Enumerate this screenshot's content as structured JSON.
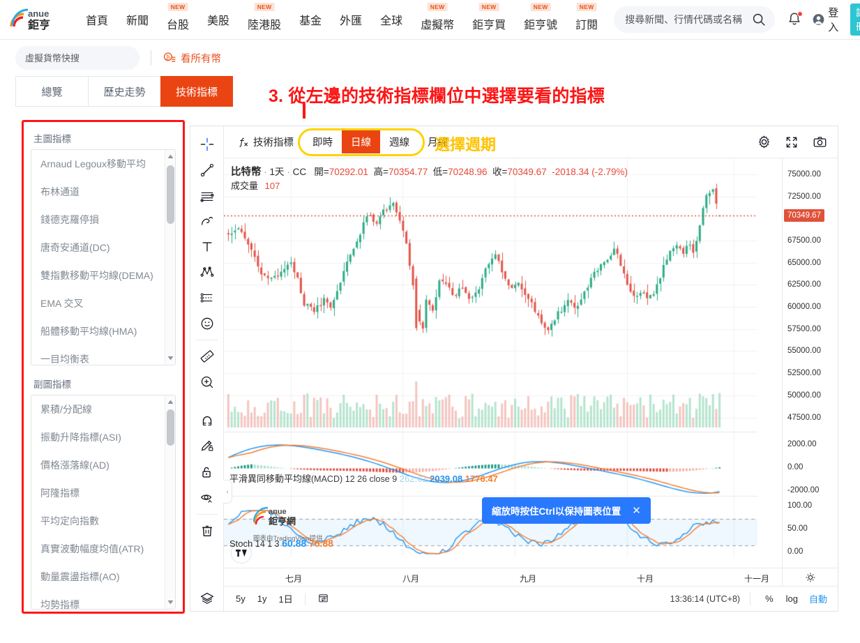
{
  "header": {
    "logo_text_top": "anue",
    "logo_text_bottom": "鉅亨",
    "nav": [
      {
        "label": "首頁",
        "badge": ""
      },
      {
        "label": "新聞",
        "badge": ""
      },
      {
        "label": "台股",
        "badge": "NEW"
      },
      {
        "label": "美股",
        "badge": ""
      },
      {
        "label": "陸港股",
        "badge": "NEW"
      },
      {
        "label": "基金",
        "badge": ""
      },
      {
        "label": "外匯",
        "badge": ""
      },
      {
        "label": "全球",
        "badge": ""
      },
      {
        "label": "虛擬幣",
        "badge": "NEW"
      },
      {
        "label": "鉅亨買",
        "badge": "NEW"
      },
      {
        "label": "鉅亨號",
        "badge": "NEW"
      },
      {
        "label": "訂閱",
        "badge": "NEW"
      }
    ],
    "search_placeholder": "搜尋新聞、行情代碼或名稱",
    "search_value": "",
    "login_label": "登入",
    "register_label": "註冊"
  },
  "subbar": {
    "coin_search_placeholder": "虛擬貨幣快搜",
    "coin_search_value": "",
    "all_coins_label": "看所有幣"
  },
  "tabs": [
    {
      "label": "總覽",
      "active": false
    },
    {
      "label": "歷史走勢",
      "active": false
    },
    {
      "label": "技術指標",
      "active": true
    }
  ],
  "annotations": {
    "step3": "3. 從左邊的技術指標欄位中選擇要看的指標",
    "period_hint": "選擇週期"
  },
  "left_panel": {
    "main_title": "主圖指標",
    "main_items": [
      "Arnaud Legoux移動平均",
      "布林通道",
      "錢德克羅停損",
      "唐奇安通道(DC)",
      "雙指數移動平均線(DEMA)",
      "EMA 交叉",
      "船體移動平均線(HMA)",
      "一目均衡表"
    ],
    "sub_title": "副圖指標",
    "sub_items": [
      "累積/分配線",
      "振動升降指標(ASI)",
      "價格漲落線(AD)",
      "阿隆指標",
      "平均定向指數",
      "真實波動幅度均值(ATR)",
      "動量震盪指標(AO)",
      "均勢指標"
    ]
  },
  "chart_toolbar": {
    "indicator_button": "技術指標",
    "periods": [
      {
        "label": "即時",
        "active": false
      },
      {
        "label": "日線",
        "active": true
      },
      {
        "label": "週線",
        "active": false
      },
      {
        "label": "月線",
        "active": false
      }
    ]
  },
  "chart_legend": {
    "symbol": "比特幣",
    "interval": "1天",
    "exchange": "CC",
    "open_label": "開=",
    "open": "70292.01",
    "high_label": "高=",
    "high": "70354.77",
    "low_label": "低=",
    "low": "70248.96",
    "close_label": "收=",
    "close": "70349.67",
    "change": "-2018.34 (-2.79%)",
    "volume_label": "成交量",
    "volume": "107"
  },
  "macd_legend": {
    "name": "平滑異同移動平均線",
    "abbr": "(MACD)",
    "params": "12 26 close 9",
    "hist": "262.61",
    "macd": "2039.08",
    "signal": "1776.47"
  },
  "stoch_legend": {
    "name": "Stoch",
    "params": "14 1 3",
    "k": "60.88",
    "d": "76.88"
  },
  "price_axis": [
    "75000.00",
    "72500.00",
    "67500.00",
    "65000.00",
    "62500.00",
    "60000.00",
    "57500.00",
    "55000.00",
    "52500.00",
    "50000.00",
    "47500.00"
  ],
  "price_axis_current": "70349.67",
  "macd_axis": [
    "2000.00",
    "0.00",
    "-2000.00"
  ],
  "stoch_axis": [
    "100.00",
    "50.00",
    "0.00"
  ],
  "time_axis": [
    "七月",
    "八月",
    "九月",
    "十月",
    "十一月"
  ],
  "bottom_bar": {
    "ranges": [
      "5y",
      "1y",
      "1日"
    ],
    "clock": "13:36:14 (UTC+8)",
    "percent": "%",
    "log": "log",
    "auto": "自動"
  },
  "tooltip": {
    "text": "縮放時按住Ctrl以保持圖表位置",
    "close": "✕"
  },
  "watermark": {
    "top": "anue",
    "bottom": "鉅亨網",
    "credit": "圖表由TradingView提供"
  },
  "colors": {
    "brand_orange": "#ea4412",
    "accent_red": "#fc1616",
    "highlight_yellow": "#ffd200",
    "up_green": "#26a69a",
    "down_red": "#e0513a",
    "blue": "#2196f3",
    "orange_line": "#f77c2e",
    "teal": "#2ec5d3"
  },
  "chart_data": {
    "type": "candlestick",
    "title": "比特幣 1天 CC",
    "ylabel": "",
    "xlabel": "",
    "ylim": [
      46000,
      76500
    ],
    "price_ticks": [
      75000,
      72500,
      70349.67,
      67500,
      65000,
      62500,
      60000,
      57500,
      55000,
      52500,
      50000,
      47500
    ],
    "x_ticks": [
      "七月",
      "八月",
      "九月",
      "十月",
      "十一月"
    ],
    "current_price": 70349.67,
    "ohlc": {
      "open": 70292.01,
      "high": 70354.77,
      "low": 70248.96,
      "close": 70349.67,
      "change": -2018.34,
      "change_pct": -2.79,
      "volume": 107
    },
    "panes": [
      {
        "name": "price+volume",
        "indicators": [
          "candles",
          "volume"
        ]
      },
      {
        "name": "MACD",
        "params": "12 26 close 9",
        "values": {
          "hist": 262.61,
          "macd": 2039.08,
          "signal": 1776.47
        },
        "ylim": [
          -3000,
          3000
        ],
        "ticks": [
          2000,
          0,
          -2000
        ]
      },
      {
        "name": "Stoch",
        "params": "14 1 3",
        "values": {
          "k": 60.88,
          "d": 76.88
        },
        "ylim": [
          0,
          100
        ],
        "ticks": [
          100,
          50,
          0
        ]
      }
    ]
  }
}
